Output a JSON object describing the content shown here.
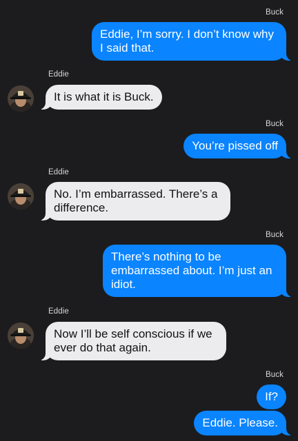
{
  "messages": [
    {
      "from": "Buck",
      "direction": "out",
      "text": "Eddie, I’m sorry. I don’t know why I said that."
    },
    {
      "from": "Eddie",
      "direction": "in",
      "text": "It is what it is Buck."
    },
    {
      "from": "Buck",
      "direction": "out",
      "text": "You’re pissed off"
    },
    {
      "from": "Eddie",
      "direction": "in",
      "text": "No. I’m embarrassed. There’s a difference."
    },
    {
      "from": "Buck",
      "direction": "out",
      "text": "There’s nothing to be embarrassed about. I’m just an idiot."
    },
    {
      "from": "Eddie",
      "direction": "in",
      "text": "Now I’ll be self conscious if we ever do that again."
    },
    {
      "from": "Buck",
      "direction": "out",
      "text": "If?"
    },
    {
      "from": "Buck",
      "direction": "out",
      "text": "Eddie. Please."
    }
  ],
  "avatar_icon": "firefighter-helmet-avatar",
  "colors": {
    "background": "#1c1c1e",
    "outgoing_bubble": "#0a84ff",
    "incoming_bubble": "#ececee"
  }
}
